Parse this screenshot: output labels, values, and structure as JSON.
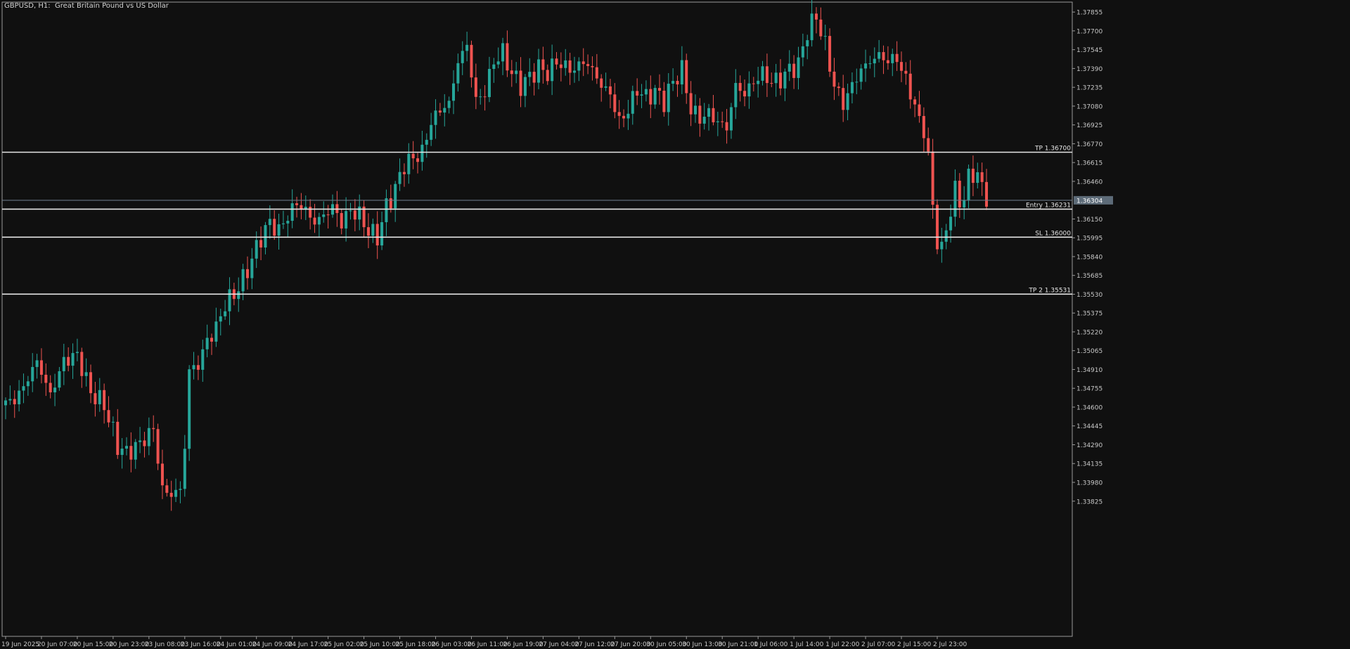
{
  "title": "GBPUSD, H1:  Great Britain Pound vs US Dollar",
  "colors": {
    "background": "#101010",
    "bull": "#26a69a",
    "bear": "#ef5350",
    "level_line": "#e6e6e6",
    "current_price_line": "#6f7f8f",
    "axis_text": "#c8c8c8",
    "frame": "#9a9a9a"
  },
  "chart_data": {
    "type": "candlestick",
    "symbol": "GBPUSD",
    "timeframe": "H1",
    "ylim": [
      1.3375,
      1.379
    ],
    "y_ticks": [
      {
        "value": 1.37855,
        "label": "1.37855"
      },
      {
        "value": 1.377,
        "label": "1.37700"
      },
      {
        "value": 1.37545,
        "label": "1.37545"
      },
      {
        "value": 1.3739,
        "label": "1.37390"
      },
      {
        "value": 1.37235,
        "label": "1.37235"
      },
      {
        "value": 1.3708,
        "label": "1.37080"
      },
      {
        "value": 1.36925,
        "label": "1.36925"
      },
      {
        "value": 1.3677,
        "label": "1.36770"
      },
      {
        "value": 1.36615,
        "label": "1.36615"
      },
      {
        "value": 1.3646,
        "label": "1.36460"
      },
      {
        "value": 1.3615,
        "label": "1.36150"
      },
      {
        "value": 1.35995,
        "label": "1.35995"
      },
      {
        "value": 1.3584,
        "label": "1.35840"
      },
      {
        "value": 1.35685,
        "label": "1.35685"
      },
      {
        "value": 1.3553,
        "label": "1.35530"
      },
      {
        "value": 1.35375,
        "label": "1.35375"
      },
      {
        "value": 1.3522,
        "label": "1.35220"
      },
      {
        "value": 1.35065,
        "label": "1.35065"
      },
      {
        "value": 1.3491,
        "label": "1.34910"
      },
      {
        "value": 1.34755,
        "label": "1.34755"
      },
      {
        "value": 1.346,
        "label": "1.34600"
      },
      {
        "value": 1.34445,
        "label": "1.34445"
      },
      {
        "value": 1.3429,
        "label": "1.34290"
      },
      {
        "value": 1.34135,
        "label": "1.34135"
      },
      {
        "value": 1.3398,
        "label": "1.33980"
      },
      {
        "value": 1.33825,
        "label": "1.33825"
      }
    ],
    "x_ticks": [
      {
        "index": 0,
        "label": "19 Jun 2025"
      },
      {
        "index": 8,
        "label": "20 Jun 07:00"
      },
      {
        "index": 16,
        "label": "20 Jun 15:00"
      },
      {
        "index": 24,
        "label": "20 Jun 23:00"
      },
      {
        "index": 32,
        "label": "23 Jun 08:00"
      },
      {
        "index": 40,
        "label": "23 Jun 16:00"
      },
      {
        "index": 48,
        "label": "24 Jun 01:00"
      },
      {
        "index": 56,
        "label": "24 Jun 09:00"
      },
      {
        "index": 64,
        "label": "24 Jun 17:00"
      },
      {
        "index": 72,
        "label": "25 Jun 02:00"
      },
      {
        "index": 80,
        "label": "25 Jun 10:00"
      },
      {
        "index": 88,
        "label": "25 Jun 18:00"
      },
      {
        "index": 96,
        "label": "26 Jun 03:00"
      },
      {
        "index": 104,
        "label": "26 Jun 11:00"
      },
      {
        "index": 112,
        "label": "26 Jun 19:00"
      },
      {
        "index": 120,
        "label": "27 Jun 04:00"
      },
      {
        "index": 128,
        "label": "27 Jun 12:00"
      },
      {
        "index": 136,
        "label": "27 Jun 20:00"
      },
      {
        "index": 144,
        "label": "30 Jun 05:00"
      },
      {
        "index": 152,
        "label": "30 Jun 13:00"
      },
      {
        "index": 160,
        "label": "30 Jun 21:00"
      },
      {
        "index": 168,
        "label": "1 Jul 06:00"
      },
      {
        "index": 176,
        "label": "1 Jul 14:00"
      },
      {
        "index": 184,
        "label": "1 Jul 22:00"
      },
      {
        "index": 192,
        "label": "2 Jul 07:00"
      },
      {
        "index": 200,
        "label": "2 Jul 15:00"
      },
      {
        "index": 208,
        "label": "2 Jul 23:00"
      }
    ],
    "levels": [
      {
        "name": "TP",
        "price": 1.367,
        "label": "TP 1.36700"
      },
      {
        "name": "Entry",
        "price": 1.36231,
        "label": "Entry 1.36231"
      },
      {
        "name": "SL",
        "price": 1.36,
        "label": "SL 1.36000"
      },
      {
        "name": "TP 2",
        "price": 1.35531,
        "label": "TP 2 1.35531"
      }
    ],
    "current_price": {
      "value": 1.36304,
      "label": "1.36304"
    },
    "waypoints": [
      [
        0,
        1.3462
      ],
      [
        3,
        1.347
      ],
      [
        7,
        1.3498
      ],
      [
        10,
        1.347
      ],
      [
        13,
        1.3498
      ],
      [
        16,
        1.3503
      ],
      [
        19,
        1.3472
      ],
      [
        22,
        1.3462
      ],
      [
        25,
        1.3428
      ],
      [
        27,
        1.3422
      ],
      [
        30,
        1.343
      ],
      [
        33,
        1.3442
      ],
      [
        35,
        1.3392
      ],
      [
        37,
        1.3388
      ],
      [
        39,
        1.3392
      ],
      [
        40,
        1.3428
      ],
      [
        41,
        1.349
      ],
      [
        43,
        1.3495
      ],
      [
        45,
        1.3515
      ],
      [
        47,
        1.3525
      ],
      [
        49,
        1.3545
      ],
      [
        51,
        1.3553
      ],
      [
        53,
        1.3565
      ],
      [
        55,
        1.3582
      ],
      [
        57,
        1.36
      ],
      [
        59,
        1.3612
      ],
      [
        61,
        1.3605
      ],
      [
        63,
        1.3618
      ],
      [
        65,
        1.3628
      ],
      [
        67,
        1.3622
      ],
      [
        69,
        1.3612
      ],
      [
        71,
        1.3618
      ],
      [
        73,
        1.3625
      ],
      [
        75,
        1.3612
      ],
      [
        77,
        1.3622
      ],
      [
        79,
        1.3618
      ],
      [
        81,
        1.3605
      ],
      [
        83,
        1.36
      ],
      [
        85,
        1.3625
      ],
      [
        87,
        1.364
      ],
      [
        89,
        1.366
      ],
      [
        91,
        1.3665
      ],
      [
        93,
        1.367
      ],
      [
        95,
        1.3695
      ],
      [
        97,
        1.3705
      ],
      [
        99,
        1.371
      ],
      [
        101,
        1.3745
      ],
      [
        103,
        1.3758
      ],
      [
        105,
        1.3712
      ],
      [
        107,
        1.372
      ],
      [
        109,
        1.3745
      ],
      [
        111,
        1.3752
      ],
      [
        113,
        1.3735
      ],
      [
        115,
        1.3725
      ],
      [
        117,
        1.3732
      ],
      [
        119,
        1.374
      ],
      [
        121,
        1.3735
      ],
      [
        123,
        1.3745
      ],
      [
        125,
        1.374
      ],
      [
        127,
        1.3738
      ],
      [
        129,
        1.3745
      ],
      [
        131,
        1.3738
      ],
      [
        133,
        1.3725
      ],
      [
        135,
        1.3718
      ],
      [
        137,
        1.3695
      ],
      [
        139,
        1.3705
      ],
      [
        141,
        1.3722
      ],
      [
        143,
        1.3715
      ],
      [
        145,
        1.372
      ],
      [
        147,
        1.3712
      ],
      [
        149,
        1.3728
      ],
      [
        151,
        1.3738
      ],
      [
        153,
        1.3705
      ],
      [
        155,
        1.3698
      ],
      [
        157,
        1.3702
      ],
      [
        159,
        1.3695
      ],
      [
        161,
        1.369
      ],
      [
        163,
        1.3725
      ],
      [
        165,
        1.3718
      ],
      [
        167,
        1.3728
      ],
      [
        169,
        1.3735
      ],
      [
        171,
        1.3728
      ],
      [
        173,
        1.373
      ],
      [
        175,
        1.3738
      ],
      [
        177,
        1.3742
      ],
      [
        179,
        1.377
      ],
      [
        181,
        1.3782
      ],
      [
        183,
        1.3758
      ],
      [
        185,
        1.3725
      ],
      [
        187,
        1.371
      ],
      [
        189,
        1.3725
      ],
      [
        191,
        1.3738
      ],
      [
        193,
        1.3745
      ],
      [
        195,
        1.375
      ],
      [
        197,
        1.3745
      ],
      [
        199,
        1.3748
      ],
      [
        200,
        1.3738
      ],
      [
        202,
        1.372
      ],
      [
        204,
        1.3695
      ],
      [
        205,
        1.369
      ],
      [
        206,
        1.3665
      ],
      [
        207,
        1.3625
      ],
      [
        208,
        1.3598
      ],
      [
        209,
        1.3588
      ],
      [
        210,
        1.3608
      ],
      [
        211,
        1.3622
      ],
      [
        212,
        1.3638
      ],
      [
        213,
        1.363
      ],
      [
        214,
        1.3632
      ],
      [
        215,
        1.365
      ],
      [
        217,
        1.3652
      ],
      [
        218,
        1.3642
      ],
      [
        219,
        1.363
      ]
    ]
  }
}
